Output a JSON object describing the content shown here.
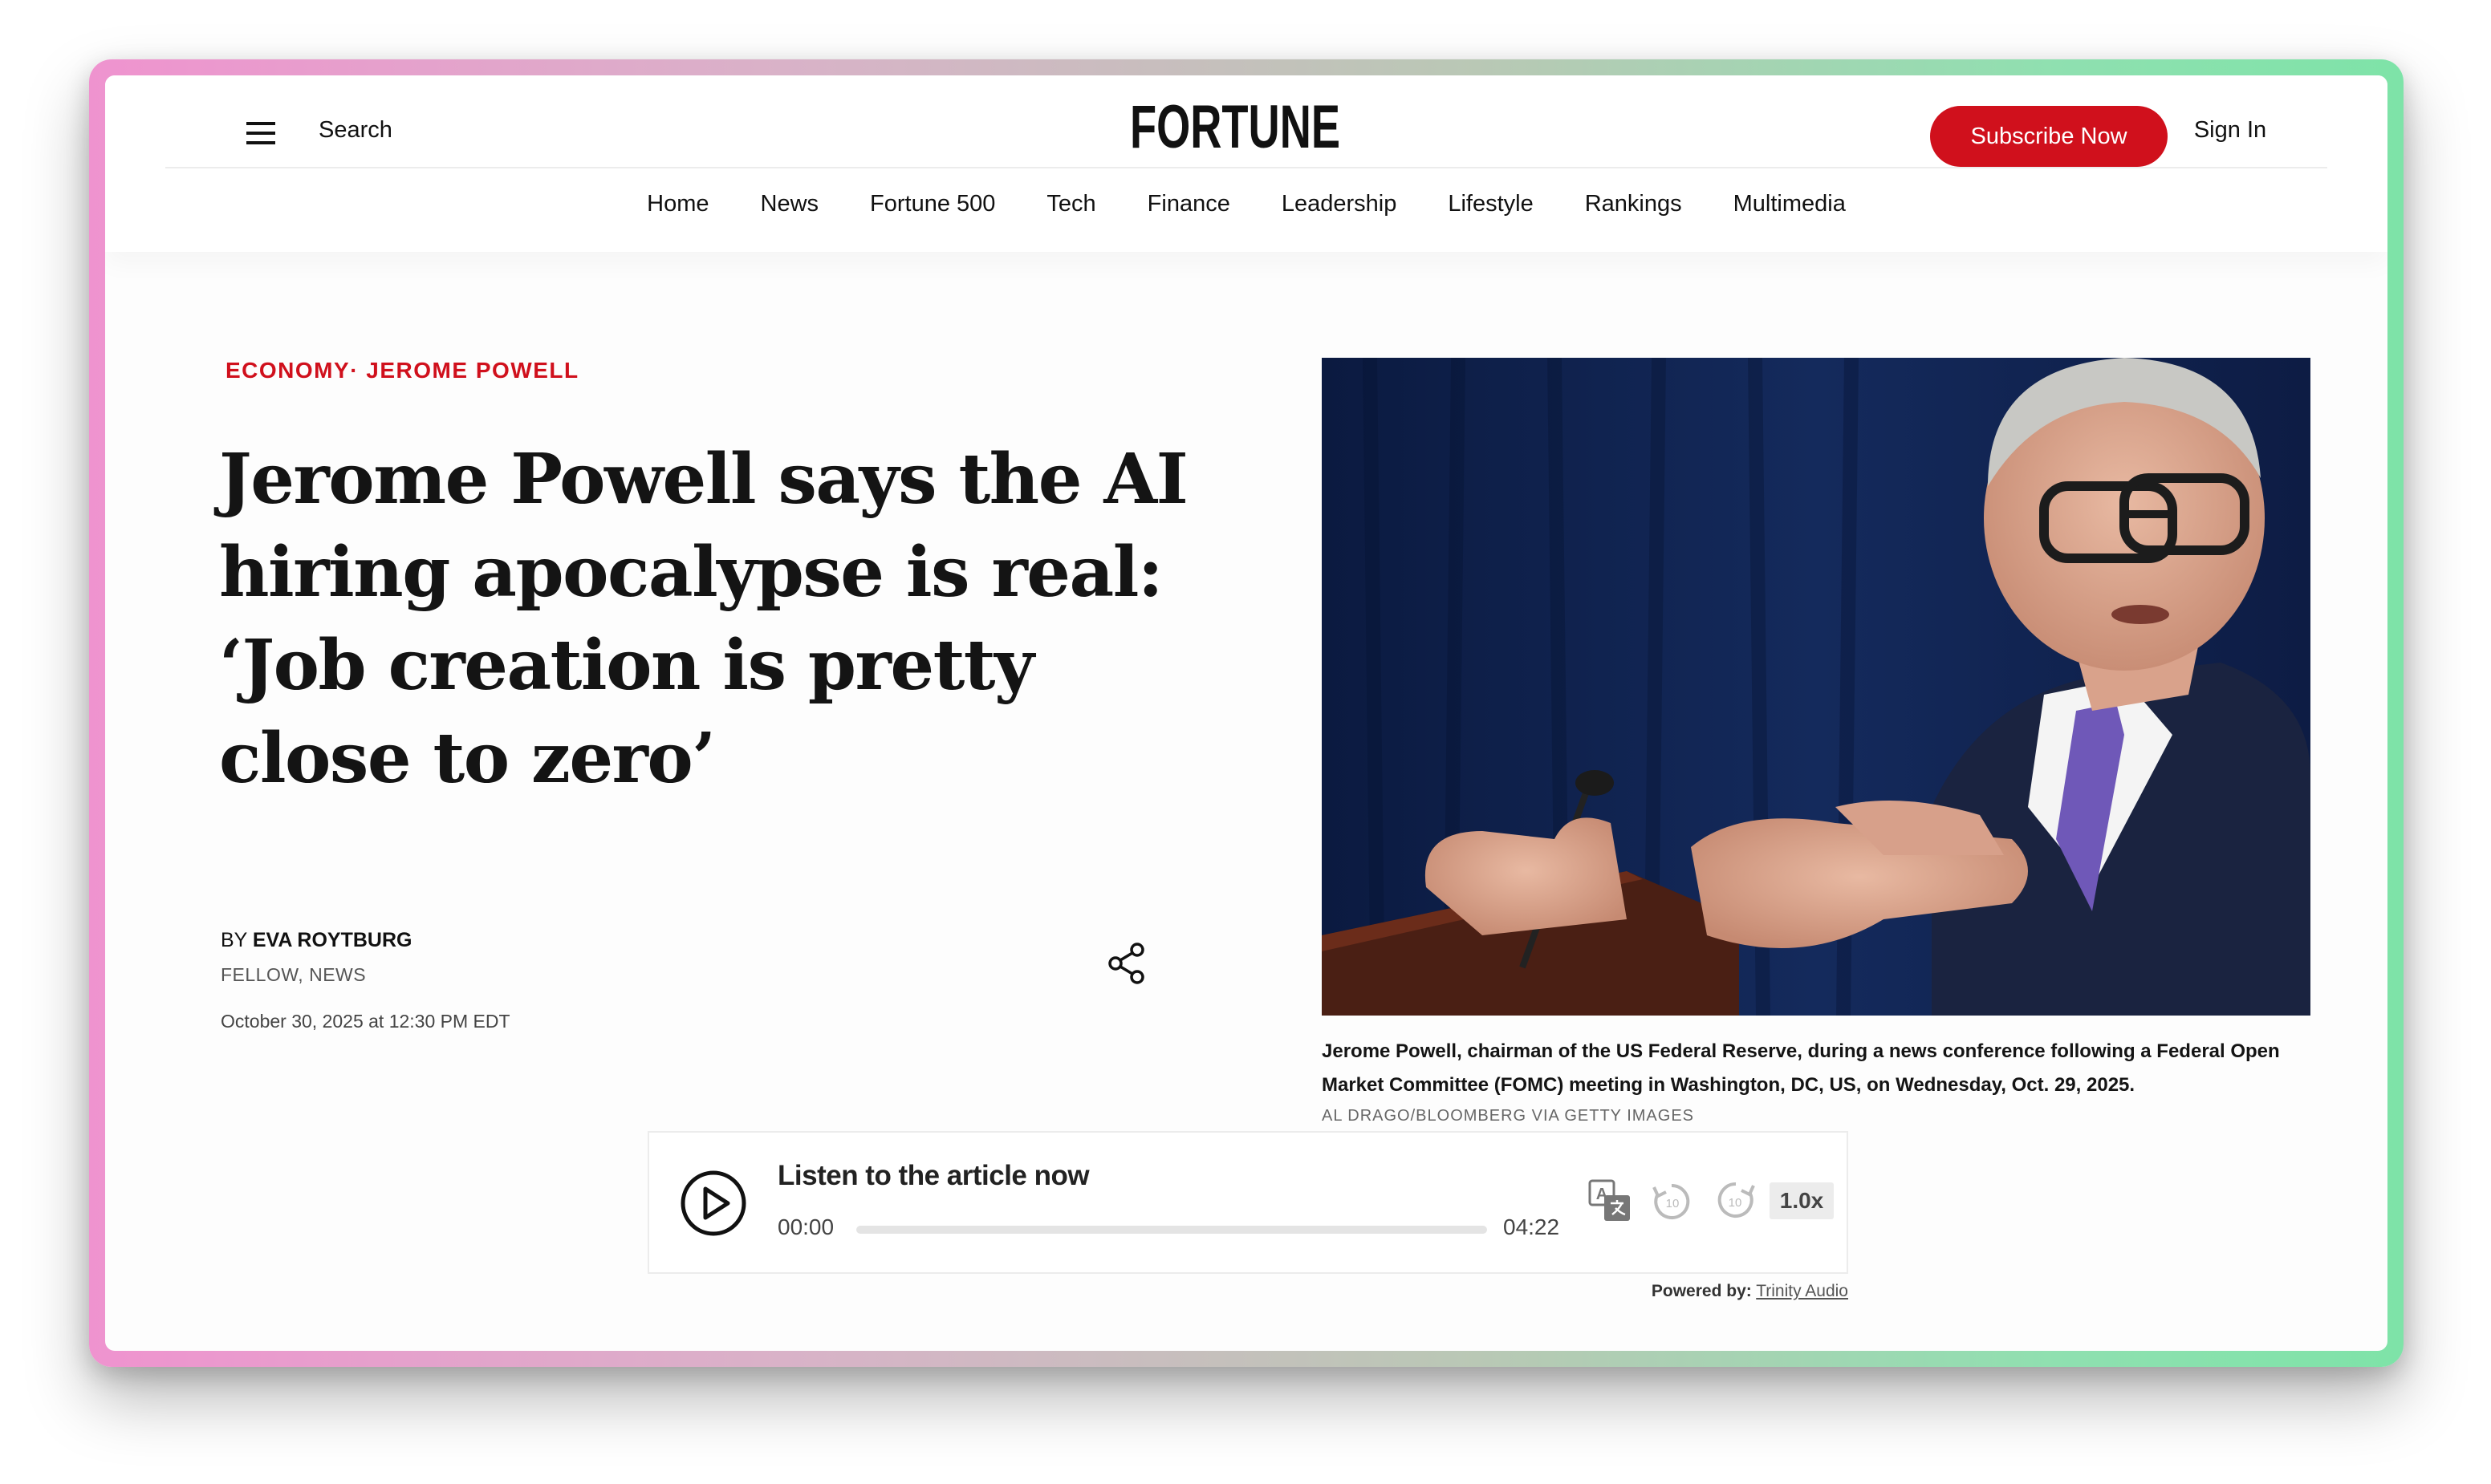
{
  "header": {
    "search_label": "Search",
    "logo_text": "FORTUNE",
    "subscribe_label": "Subscribe Now",
    "signin_label": "Sign In",
    "nav": [
      "Home",
      "News",
      "Fortune 500",
      "Tech",
      "Finance",
      "Leadership",
      "Lifestyle",
      "Rankings",
      "Multimedia"
    ]
  },
  "article": {
    "kicker_section": "ECONOMY",
    "kicker_separator": "·",
    "kicker_topic": "JEROME POWELL",
    "headline": "Jerome Powell says the AI hiring apocalypse is real: ‘Job creation is pretty close to zero’",
    "byline_prefix": "BY",
    "author": "EVA ROYTBURG",
    "author_role": "FELLOW, NEWS",
    "date": "October 30, 2025 at 12:30 PM EDT"
  },
  "photo": {
    "caption": "Jerome Powell, chairman of the US Federal Reserve, during a news conference following a Federal Open Market Committee (FOMC) meeting in Washington, DC, US, on Wednesday, Oct. 29, 2025.",
    "credit": "AL DRAGO/BLOOMBERG VIA GETTY IMAGES"
  },
  "audio": {
    "title": "Listen to the article now",
    "current_time": "00:00",
    "total_time": "04:22",
    "progress": 0,
    "speed": "1.0x",
    "powered_by_label": "Powered by:",
    "powered_by_vendor": "Trinity Audio"
  },
  "colors": {
    "accent_red": "#d0101c",
    "photo_background": "#0d1d46"
  },
  "icons": [
    "menu-icon",
    "share-icon",
    "play-icon",
    "translate-icon",
    "rewind-10-icon",
    "forward-10-icon"
  ]
}
